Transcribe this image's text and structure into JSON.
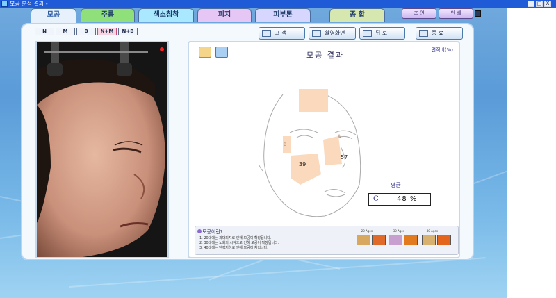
{
  "window": {
    "title": "모공 분석 결과 - ",
    "buttons": [
      "_",
      "□",
      "X"
    ]
  },
  "tabs": [
    {
      "label": "모공",
      "color": "#e6f1fb"
    },
    {
      "label": "주름",
      "color": "#8fe07a"
    },
    {
      "label": "색소침착",
      "color": "#a9e8ff"
    },
    {
      "label": "피지",
      "color": "#e6c6f5"
    },
    {
      "label": "피부톤",
      "color": "#d6d6ff"
    },
    {
      "label": "종  합",
      "color": "#d6e8b0"
    }
  ],
  "toolbar_right": {
    "advice": "조 언",
    "print": "인 쇄"
  },
  "filters": [
    {
      "label": "N",
      "selected": false
    },
    {
      "label": "M",
      "selected": false
    },
    {
      "label": "B",
      "selected": false
    },
    {
      "label": "N+M",
      "selected": true
    },
    {
      "label": "N+B",
      "selected": false
    }
  ],
  "actions": {
    "customer": "고  객",
    "capture_screen": "촬영화면",
    "back": "뒤  로",
    "exit": "종  료"
  },
  "result": {
    "title": "모공  결과",
    "ratio_label": "면적비(%)",
    "zone_a": "A",
    "zone_b": "B",
    "value_cheek": "39",
    "value_nose": "57",
    "average_label": "평균",
    "average_letter": "C",
    "average_value": "48 %"
  },
  "info": {
    "title": "모공이란?",
    "lines": [
      "1. 20대에는 과다피지로 인해 모공이 확장됩니다.",
      "2. 30대에는 노화의 시작으로 인해 모공이 확장됩니다.",
      "3. 40대에는 탄력저하로 인해 모공이 처집니다."
    ],
    "ages": [
      "- 20 Ages -",
      "- 30 Ages -",
      "- 40 Ages -"
    ]
  }
}
